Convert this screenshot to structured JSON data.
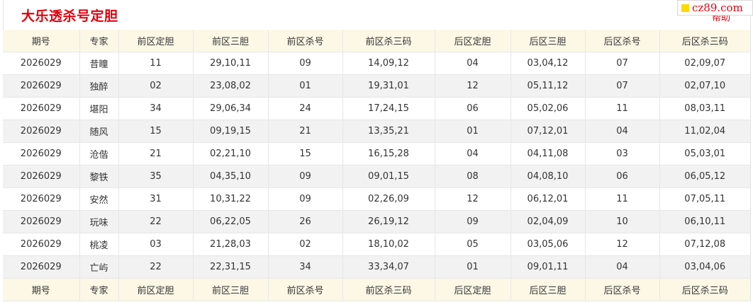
{
  "page": {
    "title": "大乐透杀号定胆",
    "help": "帮助",
    "watermark": "cz89.com"
  },
  "table": {
    "headers": [
      "期号",
      "专家",
      "前区定胆",
      "前区三胆",
      "前区杀号",
      "前区杀三码",
      "后区定胆",
      "后区三胆",
      "后区杀号",
      "后区杀三码"
    ],
    "rows": [
      [
        "2026029",
        "昔瞳",
        "11",
        "29,10,11",
        "09",
        "14,09,12",
        "04",
        "03,04,12",
        "07",
        "02,09,07"
      ],
      [
        "2026029",
        "独醉",
        "02",
        "23,08,02",
        "01",
        "19,31,01",
        "12",
        "05,11,12",
        "07",
        "02,07,10"
      ],
      [
        "2026029",
        "堪阳",
        "34",
        "29,06,34",
        "24",
        "17,24,15",
        "06",
        "05,02,06",
        "11",
        "08,03,11"
      ],
      [
        "2026029",
        "随风",
        "15",
        "09,19,15",
        "21",
        "13,35,21",
        "01",
        "07,12,01",
        "04",
        "11,02,04"
      ],
      [
        "2026029",
        "沧偕",
        "21",
        "02,21,10",
        "15",
        "16,15,28",
        "04",
        "04,11,08",
        "03",
        "05,03,01"
      ],
      [
        "2026029",
        "黎铁",
        "35",
        "04,35,10",
        "09",
        "09,01,15",
        "08",
        "04,08,10",
        "06",
        "06,05,12"
      ],
      [
        "2026029",
        "安然",
        "31",
        "10,31,22",
        "09",
        "02,26,09",
        "12",
        "06,12,01",
        "11",
        "07,05,11"
      ],
      [
        "2026029",
        "玩味",
        "22",
        "06,22,05",
        "26",
        "26,19,12",
        "09",
        "02,04,09",
        "10",
        "06,10,11"
      ],
      [
        "2026029",
        "桃凌",
        "03",
        "21,28,03",
        "02",
        "18,10,02",
        "05",
        "03,05,06",
        "12",
        "07,12,08"
      ],
      [
        "2026029",
        "亡屿",
        "22",
        "22,31,15",
        "34",
        "33,34,07",
        "01",
        "09,01,11",
        "04",
        "03,04,06"
      ]
    ]
  }
}
